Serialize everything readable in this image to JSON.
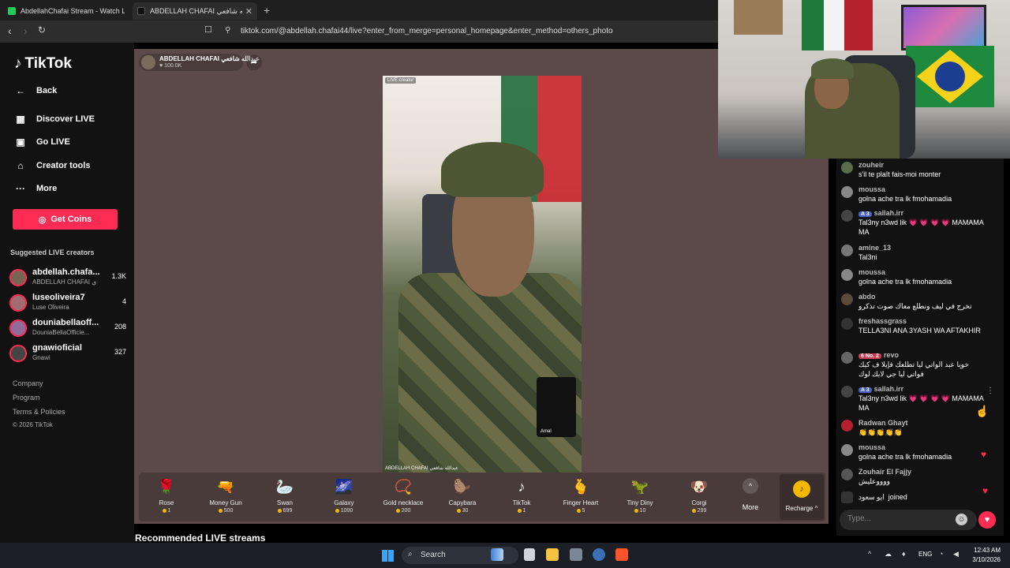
{
  "browser": {
    "tabs": [
      {
        "title": "AbdellahChafai Stream - Watch Live o",
        "favicon_color": "#24c95c"
      },
      {
        "title": "ABDELLAH CHAFAI عبدالله شافعي",
        "favicon_color": "#111111"
      }
    ],
    "new_tab": "+",
    "url": "tiktok.com/@abdellah.chafai44/live?enter_from_merge=personal_homepage&enter_method=others_photo"
  },
  "sidebar": {
    "logo": "TikTok",
    "nav": [
      {
        "label": "Back",
        "icon": "back-arrow-icon"
      },
      {
        "label": "Discover LIVE",
        "icon": "live-calendar-icon"
      },
      {
        "label": "Go LIVE",
        "icon": "camera-icon"
      },
      {
        "label": "Creator tools",
        "icon": "lightbulb-icon"
      },
      {
        "label": "More",
        "icon": "ellipsis-icon"
      }
    ],
    "get_coins": "Get Coins",
    "suggested_heading": "Suggested LIVE creators",
    "suggested": [
      {
        "name": "abdellah.chafa...",
        "sub": "ABDELLAH CHAFAI ي",
        "count": "1.3K",
        "color": "#7a6552"
      },
      {
        "name": "luseoliveira7",
        "sub": "Luse Oliveira",
        "count": "4",
        "color": "#a06c72"
      },
      {
        "name": "douniabellaoff...",
        "sub": "DouniaBellaOfficie...",
        "count": "208",
        "color": "#8f6a9b"
      },
      {
        "name": "gnawioficial",
        "sub": "Gnawi",
        "count": "327",
        "color": "#444444"
      }
    ],
    "footer": [
      "Company",
      "Program",
      "Terms & Policies",
      "© 2026 TikTok"
    ]
  },
  "stream": {
    "host_name": "ABDELLAH CHAFAI عبدالله شافعي",
    "host_likes": "100.0K",
    "live_tag": "LIVE creator",
    "video_caption": "ABDELLAH CHAFAI عبدالله شافعي",
    "pip_label": "Amal",
    "recommended": "Recommended LIVE streams"
  },
  "gifts": [
    {
      "name": "Rose",
      "price": "1",
      "icon": "🌹"
    },
    {
      "name": "Money Gun",
      "price": "500",
      "icon": "🔫"
    },
    {
      "name": "Swan",
      "price": "699",
      "icon": "🦢"
    },
    {
      "name": "Galaxy",
      "price": "1000",
      "icon": "🌌"
    },
    {
      "name": "Gold necklace",
      "price": "200",
      "icon": "📿"
    },
    {
      "name": "Capybara",
      "price": "30",
      "icon": "🦫"
    },
    {
      "name": "TikTok",
      "price": "1",
      "icon": "♪"
    },
    {
      "name": "Finger Heart",
      "price": "5",
      "icon": "🫰"
    },
    {
      "name": "Tiny Diny",
      "price": "10",
      "icon": "🦖"
    },
    {
      "name": "Corgi",
      "price": "299",
      "icon": "🐶"
    }
  ],
  "gift_more": "More",
  "recharge": "Recharge ^",
  "chat": {
    "messages": [
      {
        "user": "zouheir",
        "badge": "",
        "text": "s'il te plaît fais-moi monter"
      },
      {
        "user": "moussa",
        "badge": "",
        "text": "golna ache tra lk fmohamadia"
      },
      {
        "user": "sallah.irr",
        "badge": "A 3",
        "text": "Tal3ny n3wd lik 💗 💗 💗 💗 MAMAMA MA"
      },
      {
        "user": "amine_13",
        "badge": "",
        "text": "Tal3ni"
      },
      {
        "user": "moussa",
        "badge": "",
        "text": "golna ache tra lk fmohamadia"
      },
      {
        "user": "abdo",
        "badge": "",
        "text": "تخرج في ليف ونطلع معاك صوت تذكرو"
      },
      {
        "user": "freshassgrass",
        "badge": "",
        "text": "TELLA3NI ANA 3YASH WA AFTAKHIR"
      },
      {
        "user": "revo",
        "badge": "6 No. 2",
        "text": "خويا عبد الواتي ليا تطلعك فإيلا ف كيك فواتي ليا جي لايك لوك"
      },
      {
        "user": "sallah.irr",
        "badge": "A 3",
        "text": "Tal3ny n3wd lik 💗 💗 💗 💗 MAMAMA MA"
      },
      {
        "user": "Radwan Ghayt",
        "badge": "",
        "text": "👏👏👏👏👏"
      },
      {
        "user": "moussa",
        "badge": "",
        "text": "golna ache tra lk fmohamadia"
      },
      {
        "user": "Zouhair El Fajjy",
        "badge": "",
        "text": "ووووعليش"
      }
    ],
    "join_user": "ابو سعود",
    "join_text": "joined",
    "input_placeholder": "Type..."
  },
  "taskbar": {
    "search_label": "Search",
    "lang": "ENG",
    "time": "12:43 AM",
    "date": "3/10/2026"
  }
}
